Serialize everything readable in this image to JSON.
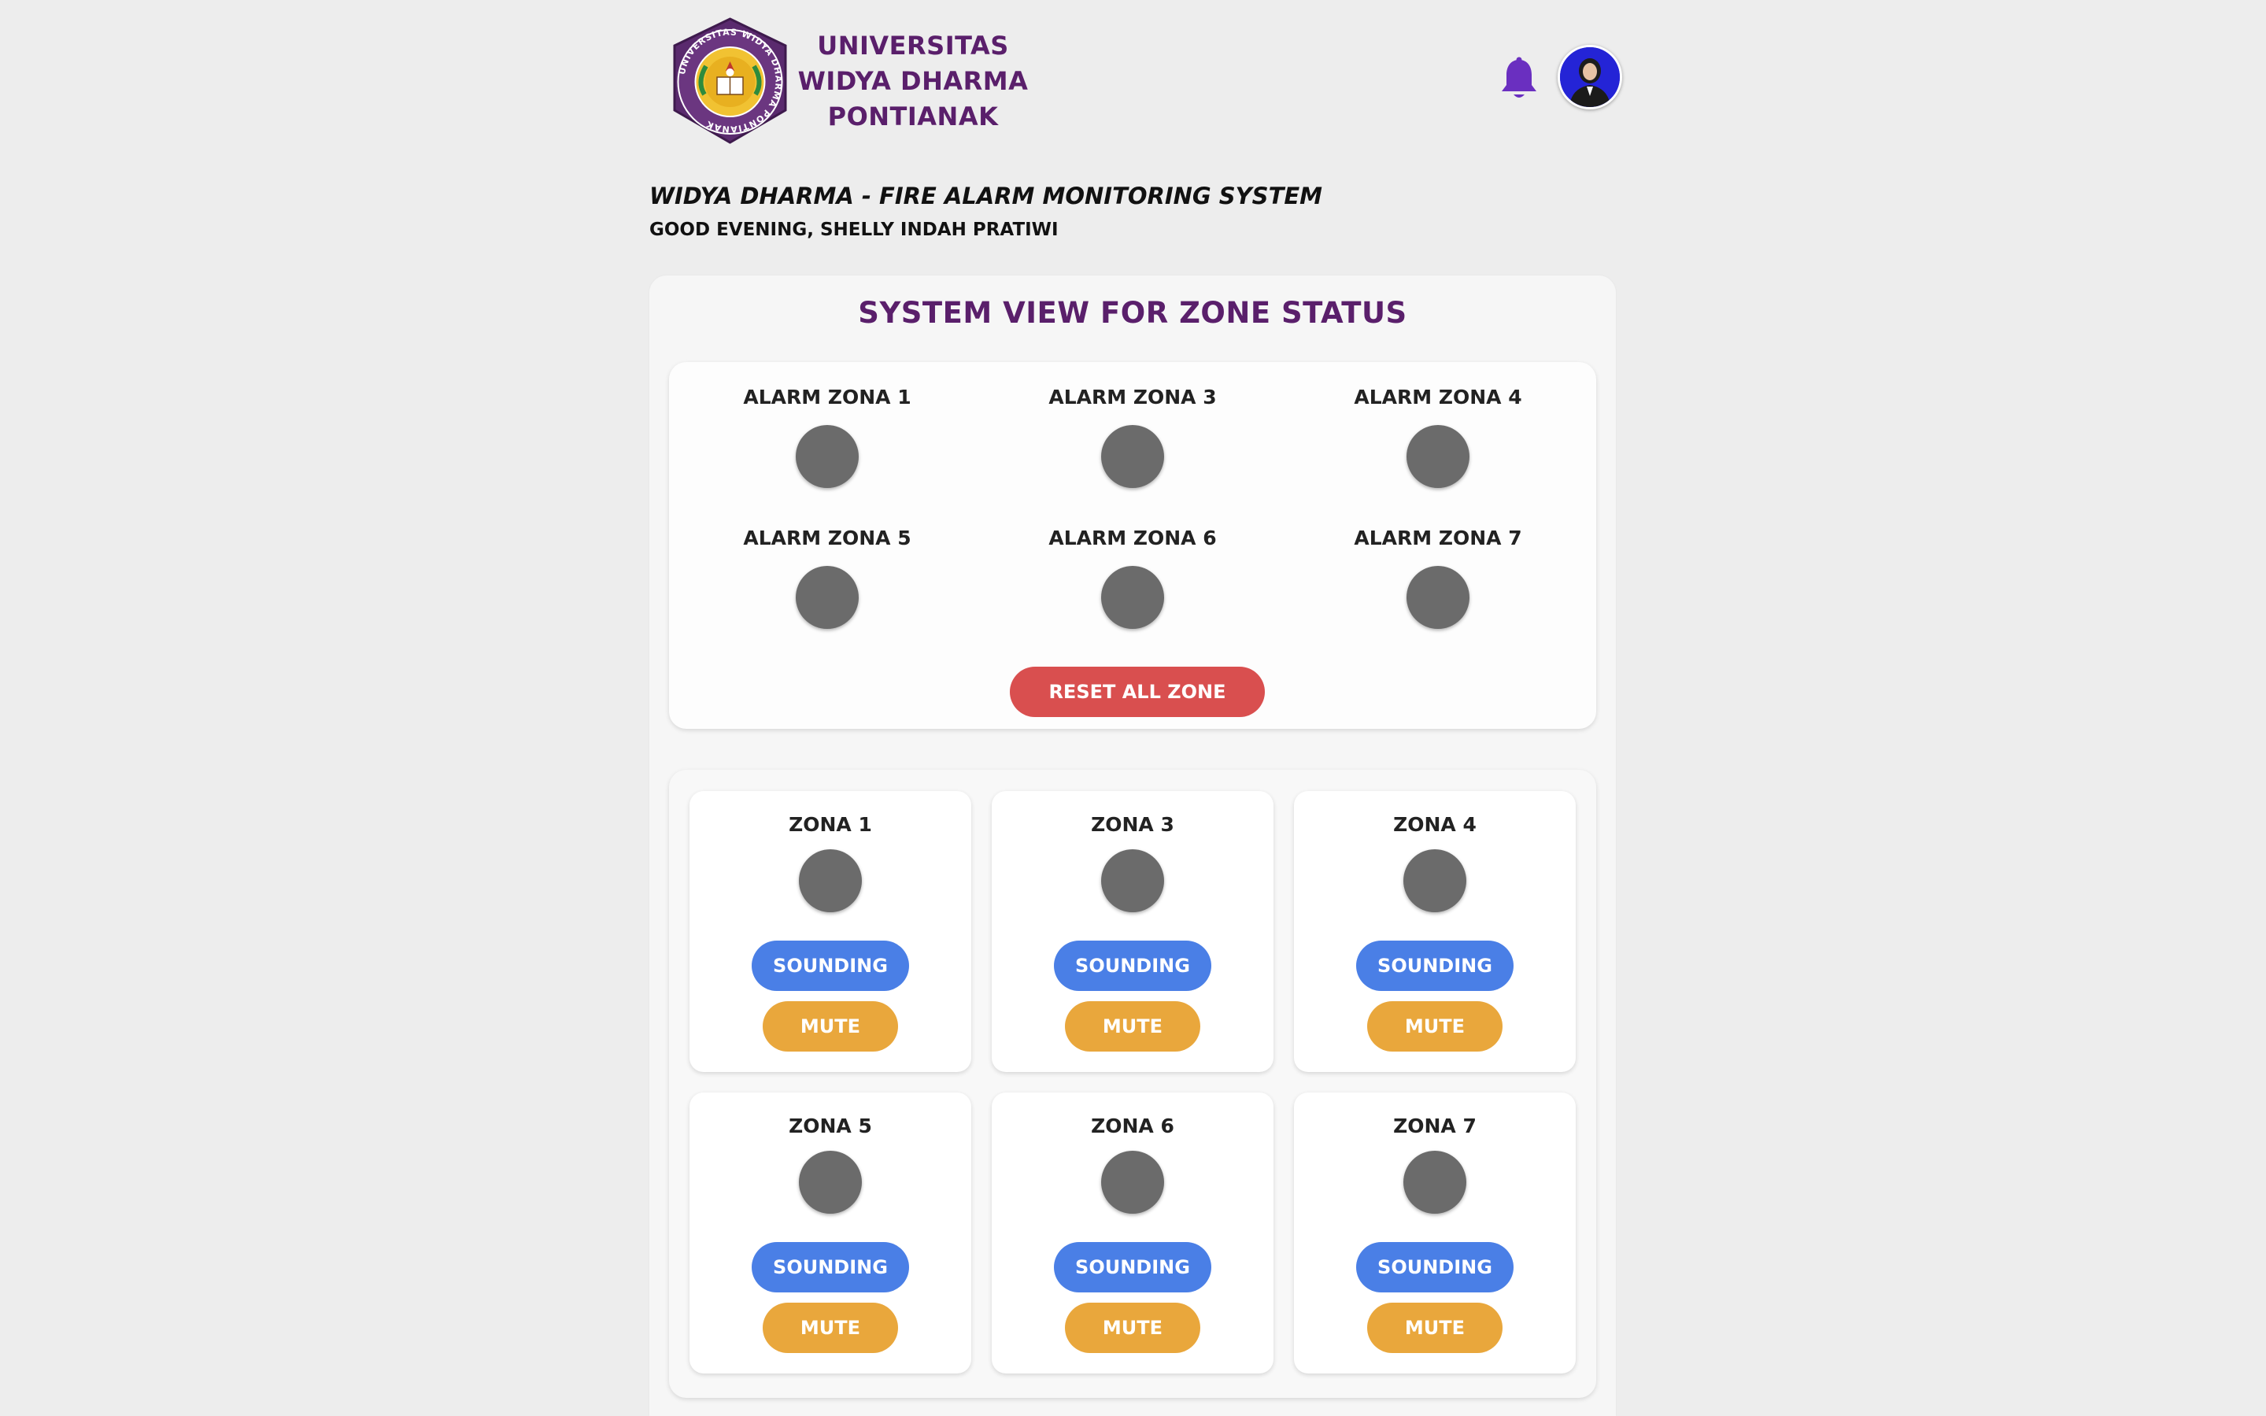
{
  "header": {
    "university_name": "UNIVERSITAS\nWIDYA DHARMA\nPONTIANAK",
    "logo_ring_text": "UNIVERSITAS WIDYA DHARMA PONTIANAK",
    "notification_icon": "bell-icon",
    "avatar_icon": "user-avatar"
  },
  "intro": {
    "system_title": "WIDYA DHARMA - FIRE ALARM MONITORING SYSTEM",
    "greeting": "GOOD EVENING, SHELLY INDAH PRATIWI"
  },
  "panel": {
    "title": "SYSTEM VIEW FOR ZONE STATUS",
    "alarms": [
      {
        "label": "ALARM ZONA 1"
      },
      {
        "label": "ALARM ZONA 3"
      },
      {
        "label": "ALARM ZONA 4"
      },
      {
        "label": "ALARM ZONA 5"
      },
      {
        "label": "ALARM ZONA 6"
      },
      {
        "label": "ALARM ZONA 7"
      }
    ],
    "reset_label": "RESET ALL ZONE",
    "zones": [
      {
        "label": "ZONA 1",
        "sound_label": "SOUNDING",
        "mute_label": "MUTE"
      },
      {
        "label": "ZONA 3",
        "sound_label": "SOUNDING",
        "mute_label": "MUTE"
      },
      {
        "label": "ZONA 4",
        "sound_label": "SOUNDING",
        "mute_label": "MUTE"
      },
      {
        "label": "ZONA 5",
        "sound_label": "SOUNDING",
        "mute_label": "MUTE"
      },
      {
        "label": "ZONA 6",
        "sound_label": "SOUNDING",
        "mute_label": "MUTE"
      },
      {
        "label": "ZONA 7",
        "sound_label": "SOUNDING",
        "mute_label": "MUTE"
      }
    ]
  },
  "colors": {
    "brand_purple": "#5a1f6b",
    "indicator_off": "#6b6b6b",
    "reset_red": "#d94f4f",
    "sounding_blue": "#4a7fe6",
    "mute_orange": "#e9a73c",
    "bell_purple": "#6a2fc0"
  }
}
